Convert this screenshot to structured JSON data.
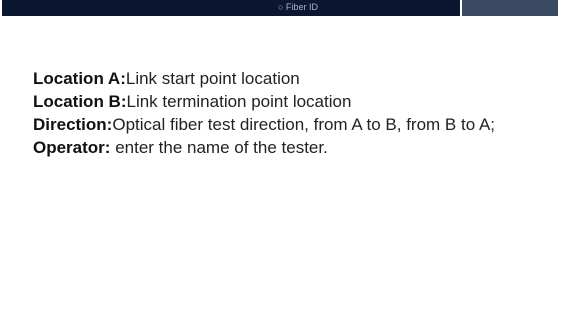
{
  "top_strip": {
    "caption": "○ Fiber ID"
  },
  "definitions": [
    {
      "term": "Location A:",
      "text": "Link start point location"
    },
    {
      "term": "Location B:",
      "text": "Link termination point location"
    },
    {
      "term": "Direction:",
      "text": "Optical fiber test direction, from A to B, from B to A;"
    },
    {
      "term": "Operator:",
      "text": " enter the name of the tester."
    }
  ]
}
